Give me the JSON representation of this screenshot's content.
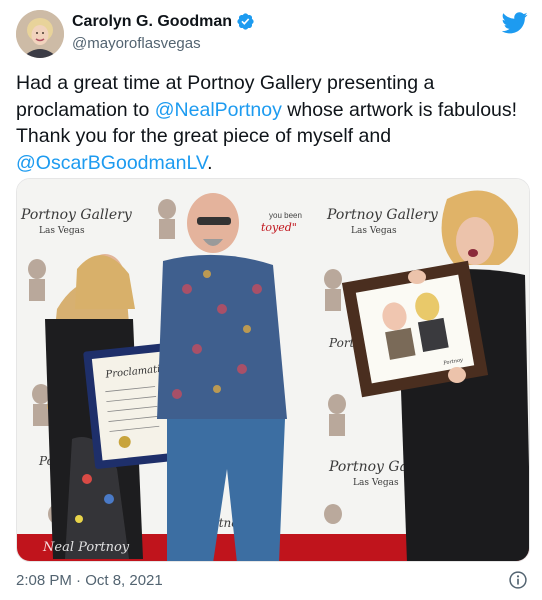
{
  "author": {
    "display_name": "Carolyn G. Goodman",
    "handle": "@mayoroflasvegas",
    "verified": true
  },
  "tweet": {
    "lines": [
      [
        {
          "t": "Had a great time at Portnoy Gallery presenting a",
          "m": false
        }
      ],
      [
        {
          "t": "proclamation to ",
          "m": false
        },
        {
          "t": "@NealPortnoy",
          "m": true
        },
        {
          "t": " whose artwork is fabulous!",
          "m": false
        }
      ],
      [
        {
          "t": "Thank you for the great piece of myself and",
          "m": false
        }
      ],
      [
        {
          "t": "@OscarBGoodmanLV",
          "m": true
        },
        {
          "t": ".",
          "m": false
        }
      ]
    ]
  },
  "photo": {
    "backdrop_text": [
      "Portnoy Gallery",
      "Las Vegas"
    ],
    "sign_fragments": [
      "you been",
      "toyed\""
    ],
    "proclamation_title": "Proclamation",
    "signature_text": "Neal Portnoy"
  },
  "footer": {
    "timestamp": "2:08 PM · Oct 8, 2021"
  },
  "colors": {
    "accent": "#1d9bf0",
    "text": "#0f1419",
    "secondary": "#536471"
  },
  "icons": {
    "brand": "twitter-bird-icon",
    "verified": "verified-badge-icon",
    "info": "info-icon"
  }
}
